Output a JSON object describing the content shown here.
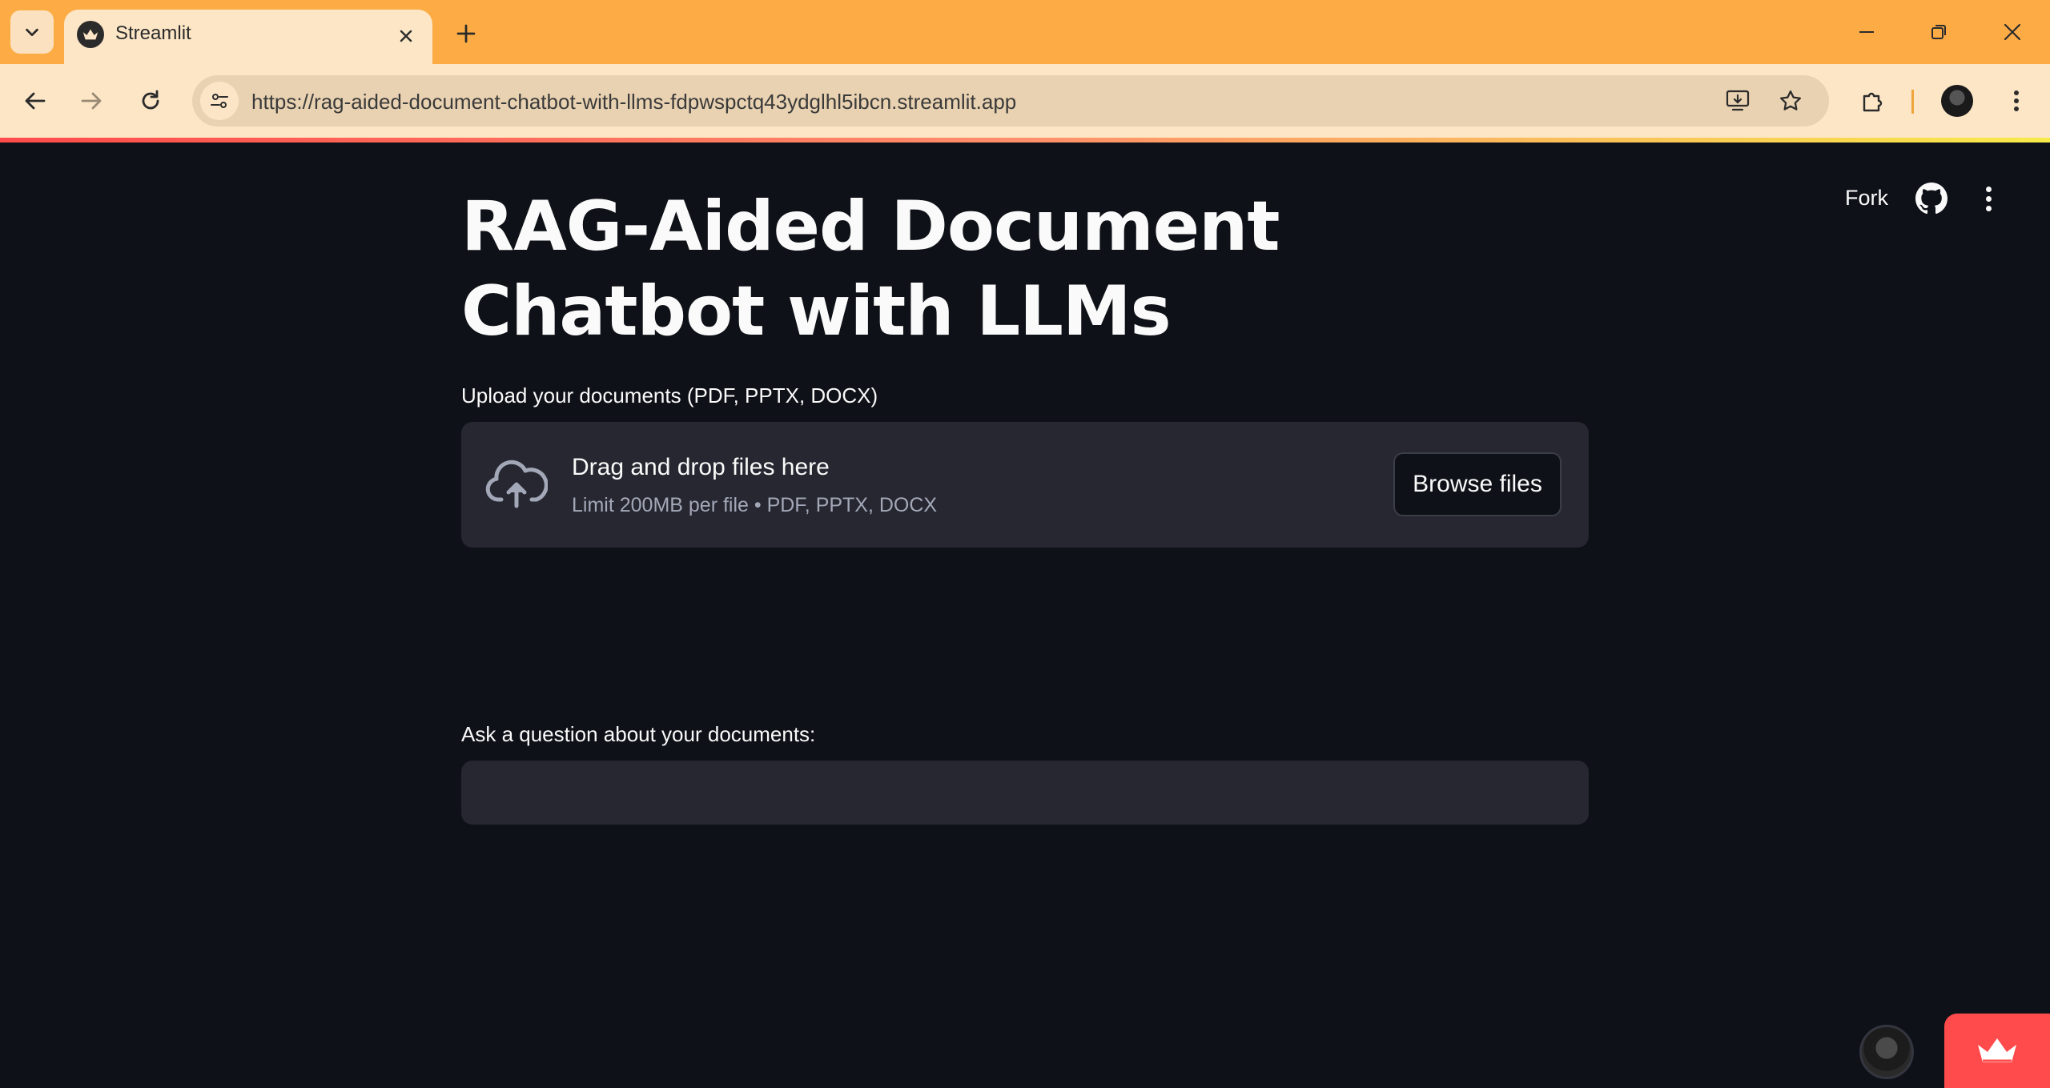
{
  "browser": {
    "tab_title": "Streamlit",
    "url": "https://rag-aided-document-chatbot-with-llms-fdpwspctq43ydglhl5ibcn.streamlit.app",
    "accent": "#fdac45"
  },
  "app_header": {
    "fork_label": "Fork"
  },
  "main": {
    "title": "RAG-Aided Document Chatbot with LLMs",
    "uploader": {
      "label": "Upload your documents (PDF, PPTX, DOCX)",
      "drop_title": "Drag and drop files here",
      "drop_subtitle": "Limit 200MB per file • PDF, PPTX, DOCX",
      "browse_label": "Browse files"
    },
    "question": {
      "label": "Ask a question about your documents:",
      "value": ""
    }
  },
  "colors": {
    "background": "#0e1117",
    "widget_bg": "#262730",
    "streamlit_red": "#ff4b4b"
  }
}
